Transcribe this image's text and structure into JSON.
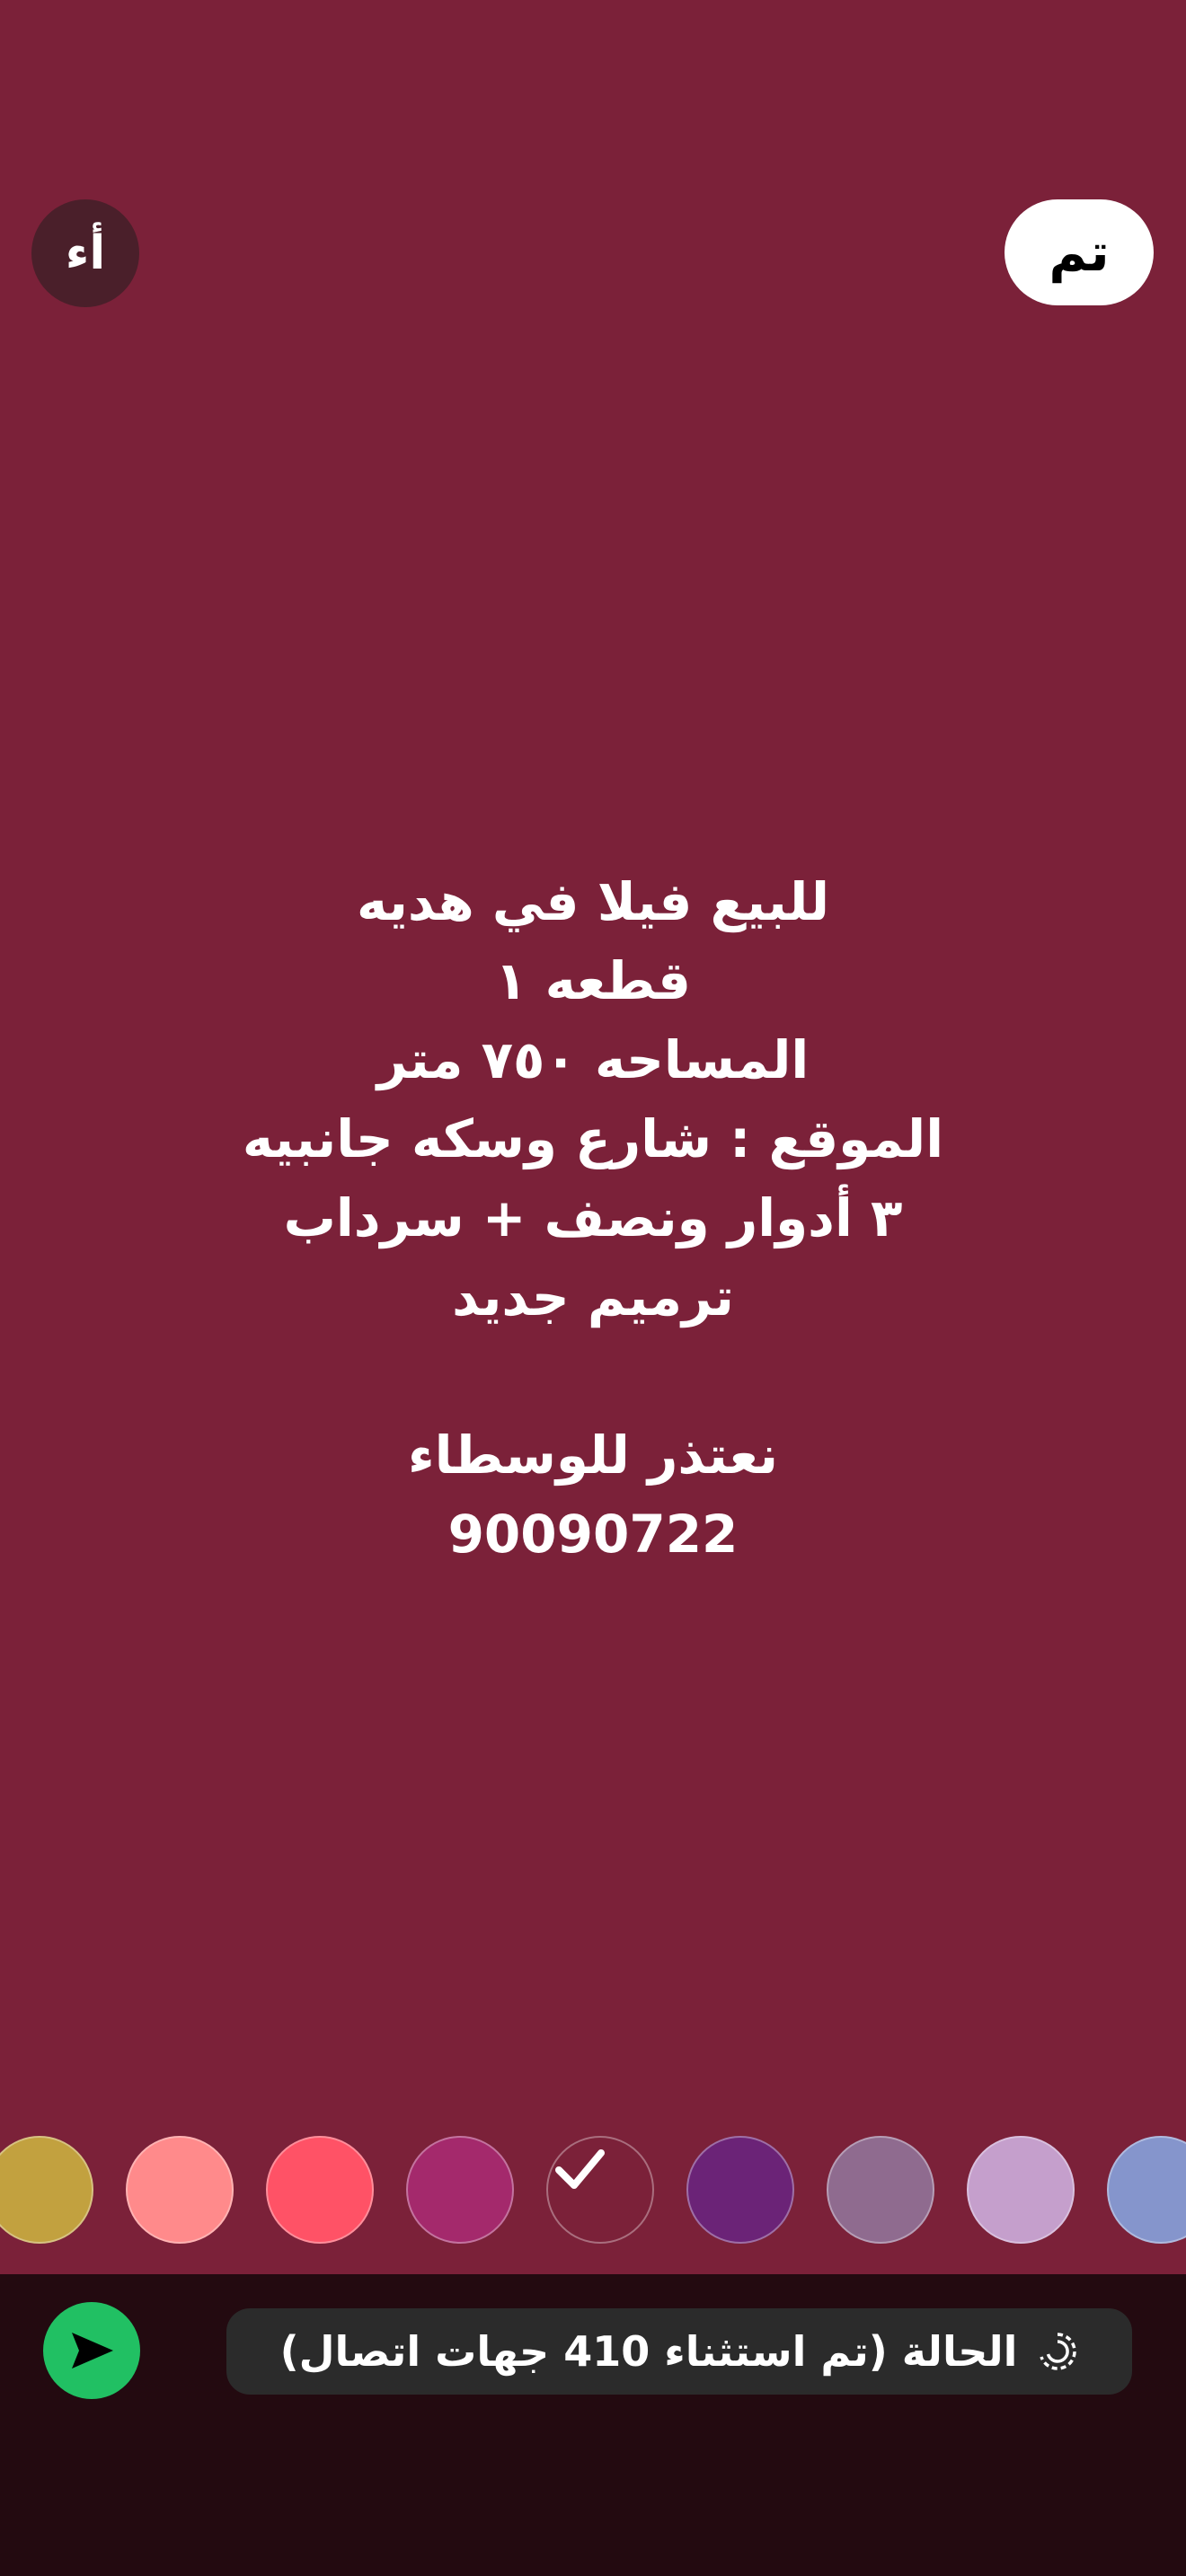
{
  "top_bar": {
    "font_button_label": "أء",
    "done_label": "تم"
  },
  "status_text": {
    "lines": [
      "للبيع فيلا في هديه",
      "قطعه ١",
      "المساحه ٧٥٠ متر",
      "الموقع : شارع وسكه جانبيه",
      "٣ أدوار ونصف + سرداب",
      "ترميم جديد",
      "",
      "نعتذر للوسطاء",
      "90090722"
    ]
  },
  "palette": {
    "colors": [
      "#c2a13f",
      "#ff8a8b",
      "#ff5266",
      "#a4296c",
      "#7b2139",
      "#6b2377",
      "#8f6b8f",
      "#c59fcc",
      "#8595cc"
    ],
    "selected_index": 4
  },
  "bottom": {
    "audience_label": "الحالة (تم استثناء 410 جهات اتصال)",
    "send_color": "#21c063"
  }
}
